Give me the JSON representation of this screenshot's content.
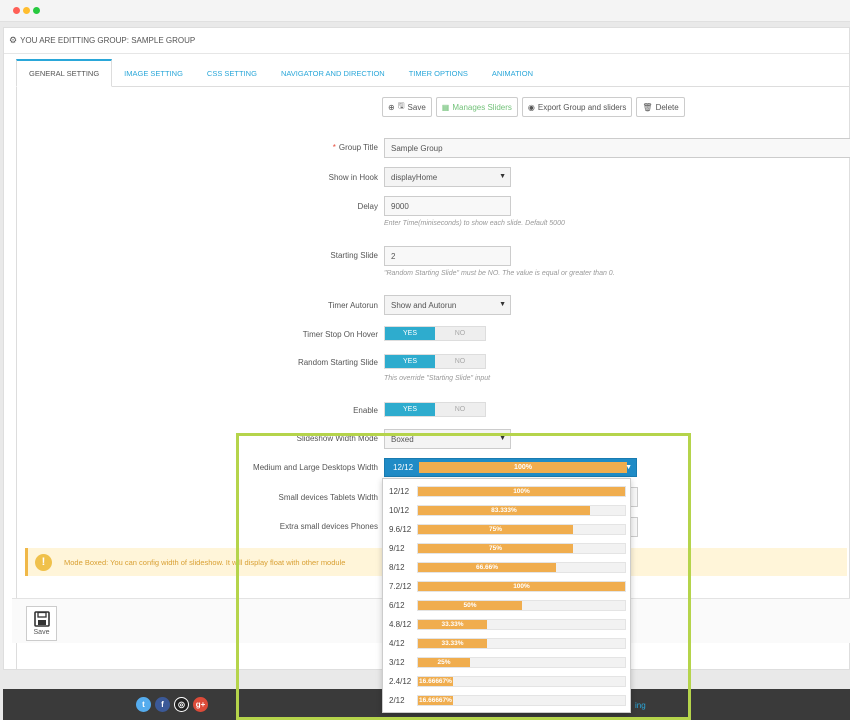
{
  "panel_title": "YOU ARE EDITTING GROUP: SAMPLE GROUP",
  "tabs": [
    "GENERAL SETTING",
    "IMAGE SETTING",
    "CSS SETTING",
    "NAVIGATOR AND DIRECTION",
    "TIMER OPTIONS",
    "ANIMATION"
  ],
  "toolbar": {
    "save": "Save",
    "manage": "Manages Sliders",
    "export": "Export Group and sliders",
    "delete": "Delete"
  },
  "form": {
    "group_title_label": "Group Title",
    "group_title_value": "Sample Group",
    "show_in_hook_label": "Show in Hook",
    "show_in_hook_value": "displayHome",
    "delay_label": "Delay",
    "delay_value": "9000",
    "delay_help": "Enter Time(miniseconds) to show each slide. Default 5000",
    "starting_slide_label": "Starting Slide",
    "starting_slide_value": "2",
    "starting_slide_help": "\"Random Starting Slide\" must be NO. The value is equal or greater than 0.",
    "timer_autorun_label": "Timer Autorun",
    "timer_autorun_value": "Show and Autorun",
    "timer_stop_label": "Timer Stop On Hover",
    "random_start_label": "Random Starting Slide",
    "random_start_help": "This override \"Starting Slide\" input",
    "enable_label": "Enable",
    "yes": "YES",
    "no": "NO",
    "width_mode_label": "Slideshow Width Mode",
    "width_mode_value": "Boxed",
    "md_width_label": "Medium and Large Desktops Width",
    "md_width_value": "12/12",
    "md_width_percent": "100%",
    "sm_width_label": "Small devices Tablets Width",
    "xs_width_label": "Extra small devices Phones"
  },
  "alert_text": "Mode Boxed: You can config width of slideshow. It will display float with other module",
  "save_button": "Save",
  "footer_link": "ing",
  "width_options": [
    {
      "label": "12/12",
      "percent": "100%",
      "fraction": 1.0
    },
    {
      "label": "10/12",
      "percent": "83.333%",
      "fraction": 0.83333
    },
    {
      "label": "9.6/12",
      "percent": "75%",
      "fraction": 0.75
    },
    {
      "label": "9/12",
      "percent": "75%",
      "fraction": 0.75
    },
    {
      "label": "8/12",
      "percent": "66.66%",
      "fraction": 0.6666
    },
    {
      "label": "7.2/12",
      "percent": "100%",
      "fraction": 1.0
    },
    {
      "label": "6/12",
      "percent": "50%",
      "fraction": 0.5
    },
    {
      "label": "4.8/12",
      "percent": "33.33%",
      "fraction": 0.3333
    },
    {
      "label": "4/12",
      "percent": "33.33%",
      "fraction": 0.3333
    },
    {
      "label": "3/12",
      "percent": "25%",
      "fraction": 0.25
    },
    {
      "label": "2.4/12",
      "percent": "16.66667%",
      "fraction": 0.1666667
    },
    {
      "label": "2/12",
      "percent": "16.66667%",
      "fraction": 0.1666667
    }
  ],
  "colors": {
    "accent": "#2aa7d9",
    "toggle_on": "#2eacce",
    "bar": "#f0ad4e",
    "highlight": "#b5d44b"
  }
}
